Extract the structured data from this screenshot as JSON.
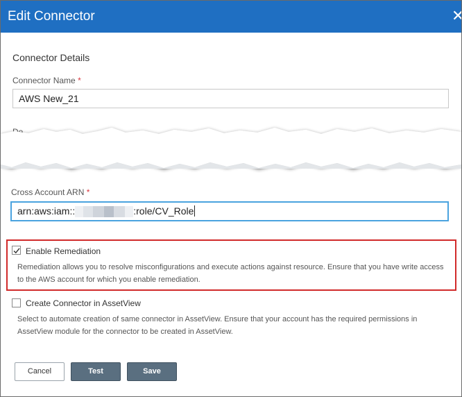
{
  "dialog": {
    "title": "Edit Connector",
    "close_glyph": "✕"
  },
  "section": {
    "title": "Connector Details"
  },
  "connector_name": {
    "label": "Connector Name",
    "required_mark": "*",
    "value": "AWS New_21"
  },
  "partial_label": "De",
  "cross_account_arn": {
    "label": "Cross Account ARN",
    "required_mark": "*",
    "value_prefix": "arn:aws:iam::",
    "value_suffix": ":role/CV_Role"
  },
  "remediation": {
    "checked": true,
    "label": "Enable Remediation",
    "description": "Remediation allows you to resolve misconfigurations and execute actions against resource. Ensure that you have write access to the AWS account for which you enable remediation.",
    "highlight_color": "#d12a2a"
  },
  "assetview": {
    "checked": false,
    "label": "Create Connector in AssetView",
    "description": "Select to automate creation of same connector in AssetView. Ensure that your account has the required permissions in AssetView module for the connector to be created in AssetView."
  },
  "buttons": {
    "cancel": "Cancel",
    "test": "Test",
    "save": "Save"
  },
  "colors": {
    "header": "#1f6fc2",
    "primary_button": "#5a6f80",
    "focus_border": "#4aa3df"
  },
  "icons": {
    "close": "close-icon",
    "check": "checkmark-icon"
  }
}
